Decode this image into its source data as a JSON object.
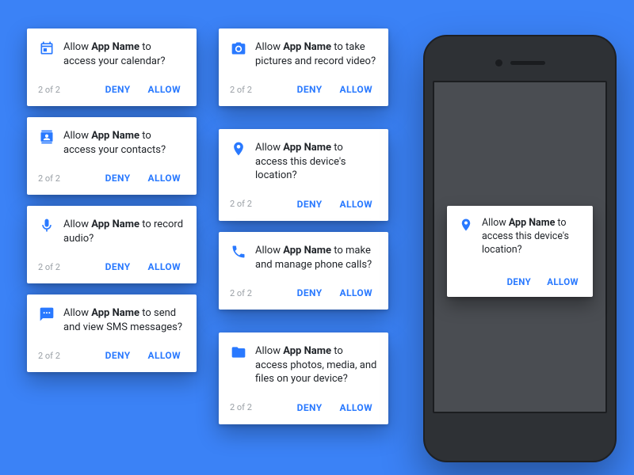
{
  "colors": {
    "accent": "#2979ff",
    "bg": "#3b82f6"
  },
  "common": {
    "prompt_prefix": "Allow ",
    "app_name": "App Name",
    "prompt_mid": " to ",
    "counter": "2 of 2",
    "deny": "DENY",
    "allow": "ALLOW"
  },
  "cards": {
    "calendar": {
      "suffix": "access your calendar?"
    },
    "contacts": {
      "suffix": "access your contacts?"
    },
    "microphone": {
      "suffix": "record audio?"
    },
    "sms": {
      "suffix": "send and view SMS messages?"
    },
    "camera": {
      "suffix": "take pictures and record video?"
    },
    "location": {
      "suffix": "access this device's location?"
    },
    "phone": {
      "suffix": "make and manage phone calls?"
    },
    "storage": {
      "suffix": "access photos, media, and files on your device?"
    }
  },
  "phone_dialog": {
    "suffix": "access this device's location?"
  }
}
